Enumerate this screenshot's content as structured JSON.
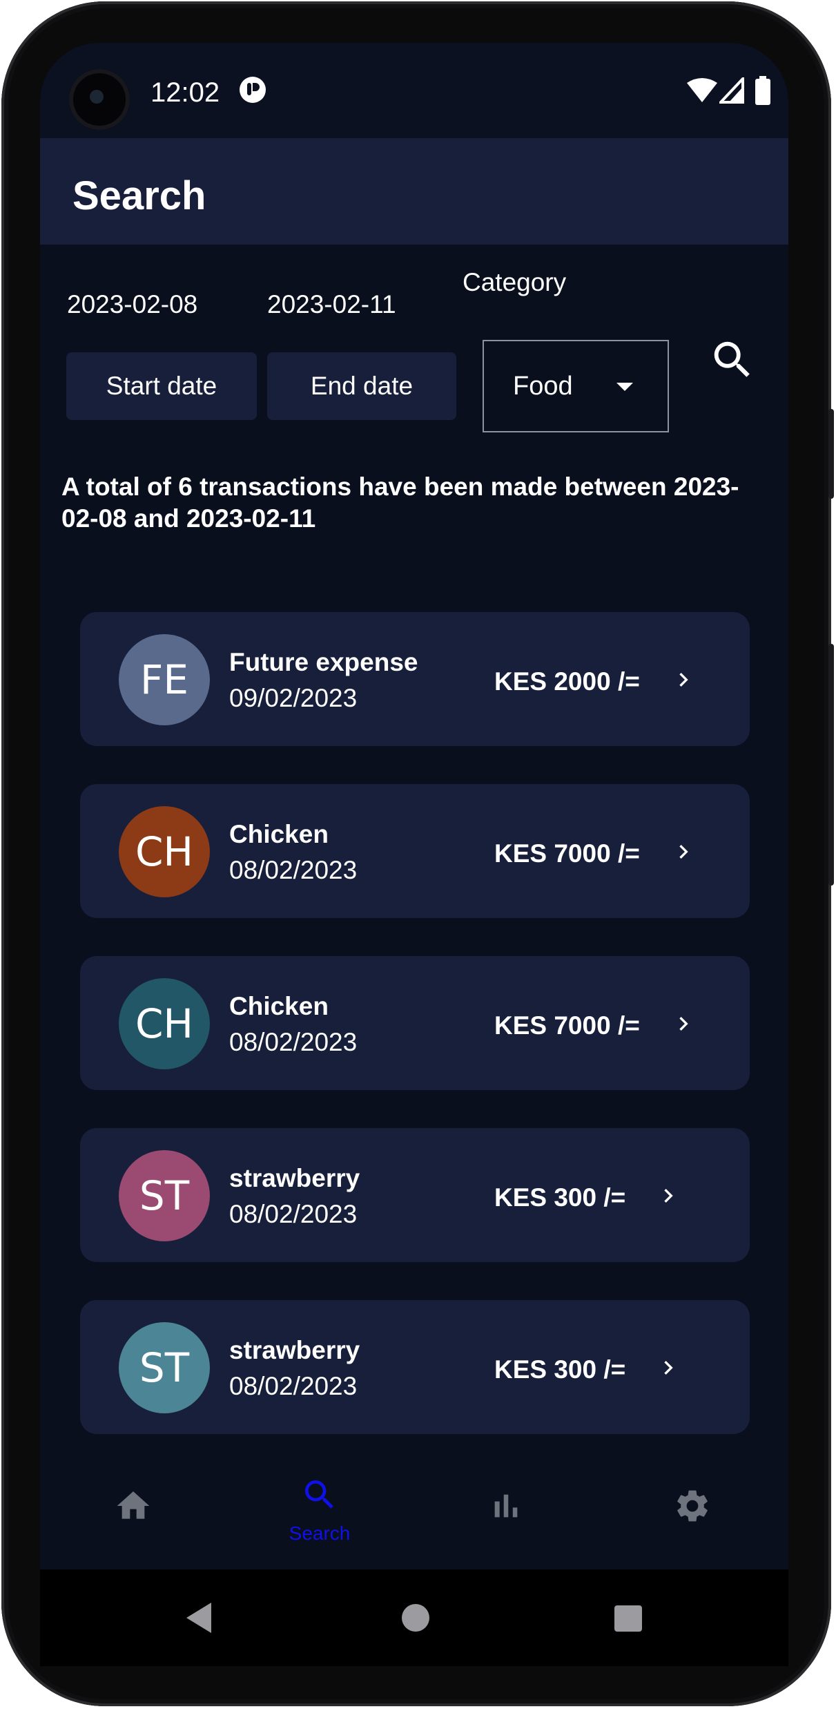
{
  "status_bar": {
    "time": "12:02"
  },
  "app_bar": {
    "title": "Search"
  },
  "filters": {
    "start_date_value": "2023-02-08",
    "end_date_value": "2023-02-11",
    "category_label": "Category",
    "start_date_button": "Start date",
    "end_date_button": "End date",
    "category_selected": "Food"
  },
  "summary_text": "A total of 6 transactions have been made between 2023-02-08 and 2023-02-11",
  "transactions": [
    {
      "initials": "FE",
      "name": "Future expense",
      "date": "09/02/2023",
      "amount": "KES 2000 /=",
      "avatar_color": "#5a6a8c"
    },
    {
      "initials": "CH",
      "name": "Chicken",
      "date": "08/02/2023",
      "amount": "KES 7000 /=",
      "avatar_color": "#8c3b16"
    },
    {
      "initials": "CH",
      "name": "Chicken",
      "date": "08/02/2023",
      "amount": "KES 7000 /=",
      "avatar_color": "#225767"
    },
    {
      "initials": "ST",
      "name": "strawberry",
      "date": "08/02/2023",
      "amount": "KES 300 /=",
      "avatar_color": "#9b4a72"
    },
    {
      "initials": "ST",
      "name": "strawberry",
      "date": "08/02/2023",
      "amount": "KES 300 /=",
      "avatar_color": "#4b8596"
    }
  ],
  "bottom_nav": {
    "items": [
      {
        "icon": "home-icon"
      },
      {
        "icon": "search-icon",
        "label": "Search",
        "active": true
      },
      {
        "icon": "bar-chart-icon"
      },
      {
        "icon": "gear-icon"
      }
    ],
    "active_color": "#1010e8",
    "inactive_color": "#6f737d"
  }
}
